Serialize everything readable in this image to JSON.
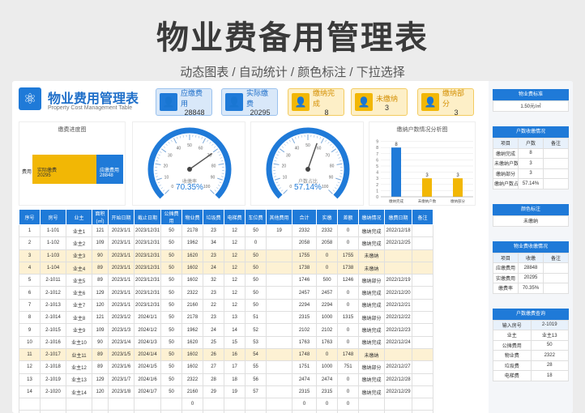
{
  "banner": {
    "title": "物业费备用管理表",
    "subtitle": "动态图表 / 自动统计 / 颜色标注 / 下拉选择"
  },
  "header": {
    "title": "物业费用管理表",
    "subtitle": "Property Cost Management Table",
    "logo_icon": "atom-icon"
  },
  "kpis": [
    {
      "label": "应缴费用",
      "value": "28848",
      "style": "blue"
    },
    {
      "label": "实际缴费",
      "value": "20295",
      "style": "blue"
    },
    {
      "label": "缴纳完成",
      "value": "8",
      "style": "yellow"
    },
    {
      "label": "未缴纳",
      "value": "3",
      "style": "yellow"
    },
    {
      "label": "缴纳部分",
      "value": "3",
      "style": "yellow"
    }
  ],
  "progress_chart": {
    "title": "缴费进度图",
    "row_label": "费用",
    "paid_label": "实际缴费",
    "paid_value": "20295",
    "due_label": "应缴费用",
    "due_value": "28848"
  },
  "gauge1": {
    "label": "收缴率",
    "value": "70.35%",
    "percent": 70.35,
    "ticks": [
      "0",
      "10",
      "20",
      "30",
      "40",
      "50",
      "60",
      "70",
      "80",
      "90",
      "100"
    ]
  },
  "gauge2": {
    "label": "户数占比",
    "value": "57.14%",
    "percent": 57.14,
    "ticks": [
      "0",
      "10",
      "20",
      "30",
      "40",
      "50",
      "60",
      "70",
      "80",
      "90",
      "100"
    ]
  },
  "chart_data": {
    "type": "bar",
    "title": "缴纳户数情况分析图",
    "categories": [
      "缴纳完成",
      "未缴纳户数",
      "缴纳部分"
    ],
    "values": [
      8,
      3,
      3
    ],
    "ylim": [
      0,
      10
    ],
    "yticks": [
      "0",
      "1",
      "2",
      "3",
      "4",
      "5",
      "6",
      "7",
      "8",
      "9"
    ],
    "colors": [
      "#1f7ad8",
      "#f2b705",
      "#f2b705"
    ]
  },
  "table": {
    "headers": [
      "序号",
      "房号",
      "业主",
      "面积(㎡)",
      "开始日期",
      "截止日期",
      "公摊费用",
      "物业费",
      "垃圾费",
      "电梯费",
      "车位费",
      "其他费用",
      "合计",
      "实缴",
      "差额",
      "缴纳情况",
      "缴费日期",
      "备注"
    ],
    "rows": [
      [
        "1",
        "1-101",
        "业主1",
        "121",
        "2023/1/1",
        "2023/12/31",
        "50",
        "2178",
        "23",
        "12",
        "50",
        "19",
        "2332",
        "2332",
        "0",
        "缴纳完成",
        "2022/12/18",
        ""
      ],
      [
        "2",
        "1-102",
        "业主2",
        "109",
        "2023/1/1",
        "2023/12/31",
        "50",
        "1962",
        "34",
        "12",
        "0",
        "",
        "2058",
        "2058",
        "0",
        "缴纳完成",
        "2022/12/25",
        ""
      ],
      [
        "3",
        "1-103",
        "业主3",
        "90",
        "2023/1/1",
        "2023/12/31",
        "50",
        "1620",
        "23",
        "12",
        "50",
        "",
        "1755",
        "0",
        "1755",
        "未缴纳",
        "",
        ""
      ],
      [
        "4",
        "1-104",
        "业主4",
        "89",
        "2023/1/1",
        "2023/12/31",
        "50",
        "1602",
        "24",
        "12",
        "50",
        "",
        "1738",
        "0",
        "1738",
        "未缴纳",
        "",
        ""
      ],
      [
        "5",
        "2-1011",
        "业主5",
        "89",
        "2023/1/1",
        "2023/12/31",
        "50",
        "1602",
        "32",
        "12",
        "50",
        "",
        "1746",
        "500",
        "1246",
        "缴纳部分",
        "2022/12/19",
        ""
      ],
      [
        "6",
        "2-1012",
        "业主6",
        "129",
        "2023/1/1",
        "2023/12/31",
        "50",
        "2322",
        "23",
        "12",
        "50",
        "",
        "2457",
        "2457",
        "0",
        "缴纳完成",
        "2022/12/20",
        ""
      ],
      [
        "7",
        "2-1013",
        "业主7",
        "120",
        "2023/1/1",
        "2023/12/31",
        "50",
        "2160",
        "22",
        "12",
        "50",
        "",
        "2294",
        "2294",
        "0",
        "缴纳完成",
        "2022/12/21",
        ""
      ],
      [
        "8",
        "2-1014",
        "业主8",
        "121",
        "2023/1/2",
        "2024/1/1",
        "50",
        "2178",
        "23",
        "13",
        "51",
        "",
        "2315",
        "1000",
        "1315",
        "缴纳部分",
        "2022/12/22",
        ""
      ],
      [
        "9",
        "2-1015",
        "业主9",
        "109",
        "2023/1/3",
        "2024/1/2",
        "50",
        "1962",
        "24",
        "14",
        "52",
        "",
        "2102",
        "2102",
        "0",
        "缴纳完成",
        "2022/12/23",
        ""
      ],
      [
        "10",
        "2-1016",
        "业主10",
        "90",
        "2023/1/4",
        "2024/1/3",
        "50",
        "1620",
        "25",
        "15",
        "53",
        "",
        "1763",
        "1763",
        "0",
        "缴纳完成",
        "2022/12/24",
        ""
      ],
      [
        "11",
        "2-1017",
        "业主11",
        "89",
        "2023/1/5",
        "2024/1/4",
        "50",
        "1602",
        "26",
        "16",
        "54",
        "",
        "1748",
        "0",
        "1748",
        "未缴纳",
        "",
        ""
      ],
      [
        "12",
        "2-1018",
        "业主12",
        "89",
        "2023/1/6",
        "2024/1/5",
        "50",
        "1602",
        "27",
        "17",
        "55",
        "",
        "1751",
        "1000",
        "751",
        "缴纳部分",
        "2022/12/27",
        ""
      ],
      [
        "13",
        "2-1019",
        "业主13",
        "129",
        "2023/1/7",
        "2024/1/6",
        "50",
        "2322",
        "28",
        "18",
        "56",
        "",
        "2474",
        "2474",
        "0",
        "缴纳完成",
        "2022/12/28",
        ""
      ],
      [
        "14",
        "2-1020",
        "业主14",
        "120",
        "2023/1/8",
        "2024/1/7",
        "50",
        "2160",
        "29",
        "19",
        "57",
        "",
        "2315",
        "2315",
        "0",
        "缴纳完成",
        "2022/12/29",
        ""
      ],
      [
        "",
        "",
        "",
        "",
        "",
        "",
        "",
        "0",
        "",
        "",
        "",
        "",
        "0",
        "0",
        "0",
        "",
        "",
        ""
      ],
      [
        "",
        "",
        "",
        "",
        "",
        "",
        "",
        "",
        "",
        "",
        "",
        "",
        "",
        "",
        "",
        "",
        "",
        ""
      ]
    ],
    "highlight_rows": [
      2,
      3,
      10
    ]
  },
  "right_panel": {
    "std_title": "物业费标准",
    "std_value": "1.50元/㎡",
    "hh_title": "户数收缴情况",
    "hh_headers": [
      "项目",
      "户数",
      "备注"
    ],
    "hh_rows": [
      [
        "缴纳完成",
        "8",
        ""
      ],
      [
        "未缴纳户数",
        "3",
        ""
      ],
      [
        "缴纳部分",
        "3",
        ""
      ],
      [
        "缴纳户数占比",
        "57.14%",
        ""
      ]
    ],
    "color_title": "颜色标注",
    "color_value": "未缴纳",
    "fee_title": "物业费收缴情况",
    "fee_headers": [
      "项目",
      "收缴",
      "备注"
    ],
    "fee_rows": [
      [
        "应缴费用",
        "28848",
        ""
      ],
      [
        "实缴费用",
        "20295",
        ""
      ],
      [
        "缴费率",
        "70.35%",
        ""
      ]
    ],
    "query_title": "户数缴费查询",
    "query_label": "输入房号",
    "query_value": "2-1019",
    "query_rows": [
      [
        "业主",
        "业主13"
      ],
      [
        "公摊费用",
        "50"
      ],
      [
        "物业费",
        "2322"
      ],
      [
        "垃圾费",
        "28"
      ],
      [
        "电梯费",
        "18"
      ]
    ]
  }
}
